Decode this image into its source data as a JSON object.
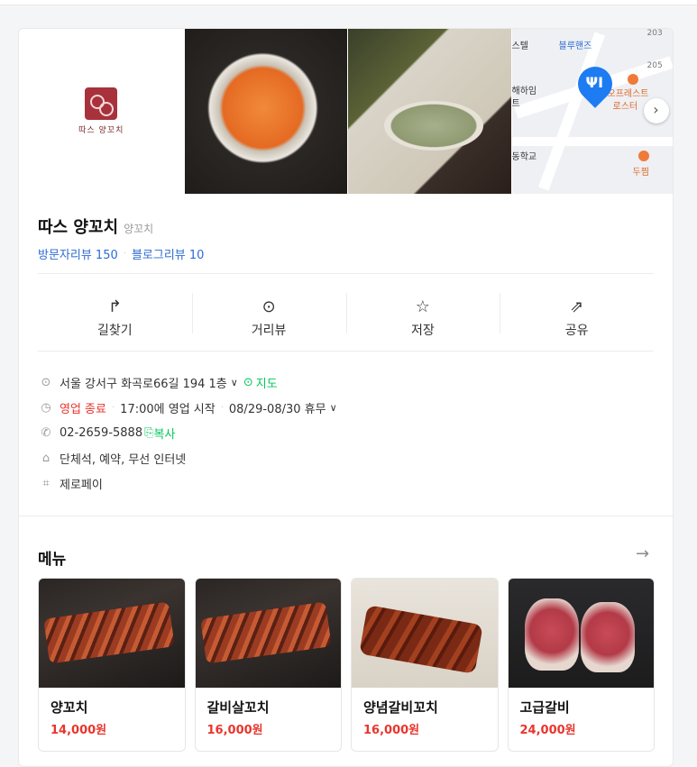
{
  "header": {},
  "photos": {
    "logo_text": "따스 양꼬치",
    "map": {
      "labels": [
        "스텔",
        "블루핸즈",
        "205",
        "해하임",
        "트",
        "오프레스트",
        "로스터",
        "동학교",
        "두찜",
        "203"
      ],
      "next_label": "›"
    }
  },
  "place": {
    "name": "따스 양꼬치",
    "category": "양꼬치",
    "visitor_reviews": "방문자리뷰 150",
    "blog_reviews": "블로그리뷰 10"
  },
  "actions": [
    {
      "label": "길찾기",
      "icon": "directions-icon",
      "glyph": "↱"
    },
    {
      "label": "거리뷰",
      "icon": "street-view-icon",
      "glyph": "⊙"
    },
    {
      "label": "저장",
      "icon": "star-icon",
      "glyph": "☆"
    },
    {
      "label": "공유",
      "icon": "share-icon",
      "glyph": "⇗"
    }
  ],
  "details": {
    "address": "서울 강서구 화곡로66길 194 1층",
    "map_link": "지도",
    "status": "영업 종료",
    "open_info": "17:00에 영업 시작",
    "holiday": "08/29-08/30 휴무",
    "phone": "02-2659-5888",
    "copy_label": "복사",
    "amenities": "단체석, 예약, 무선 인터넷",
    "payment": "제로페이"
  },
  "menu": {
    "title": "메뉴",
    "more_arrow": "→",
    "items": [
      {
        "name": "양꼬치",
        "price": "14,000원"
      },
      {
        "name": "갈비살꼬치",
        "price": "16,000원"
      },
      {
        "name": "양념갈비꼬치",
        "price": "16,000원"
      },
      {
        "name": "고급갈비",
        "price": "24,000원"
      }
    ]
  },
  "colors": {
    "link_blue": "#2d6bd4",
    "accent_green": "#03c75a",
    "status_red": "#e8352d",
    "map_pin_blue": "#1e7cf2"
  }
}
